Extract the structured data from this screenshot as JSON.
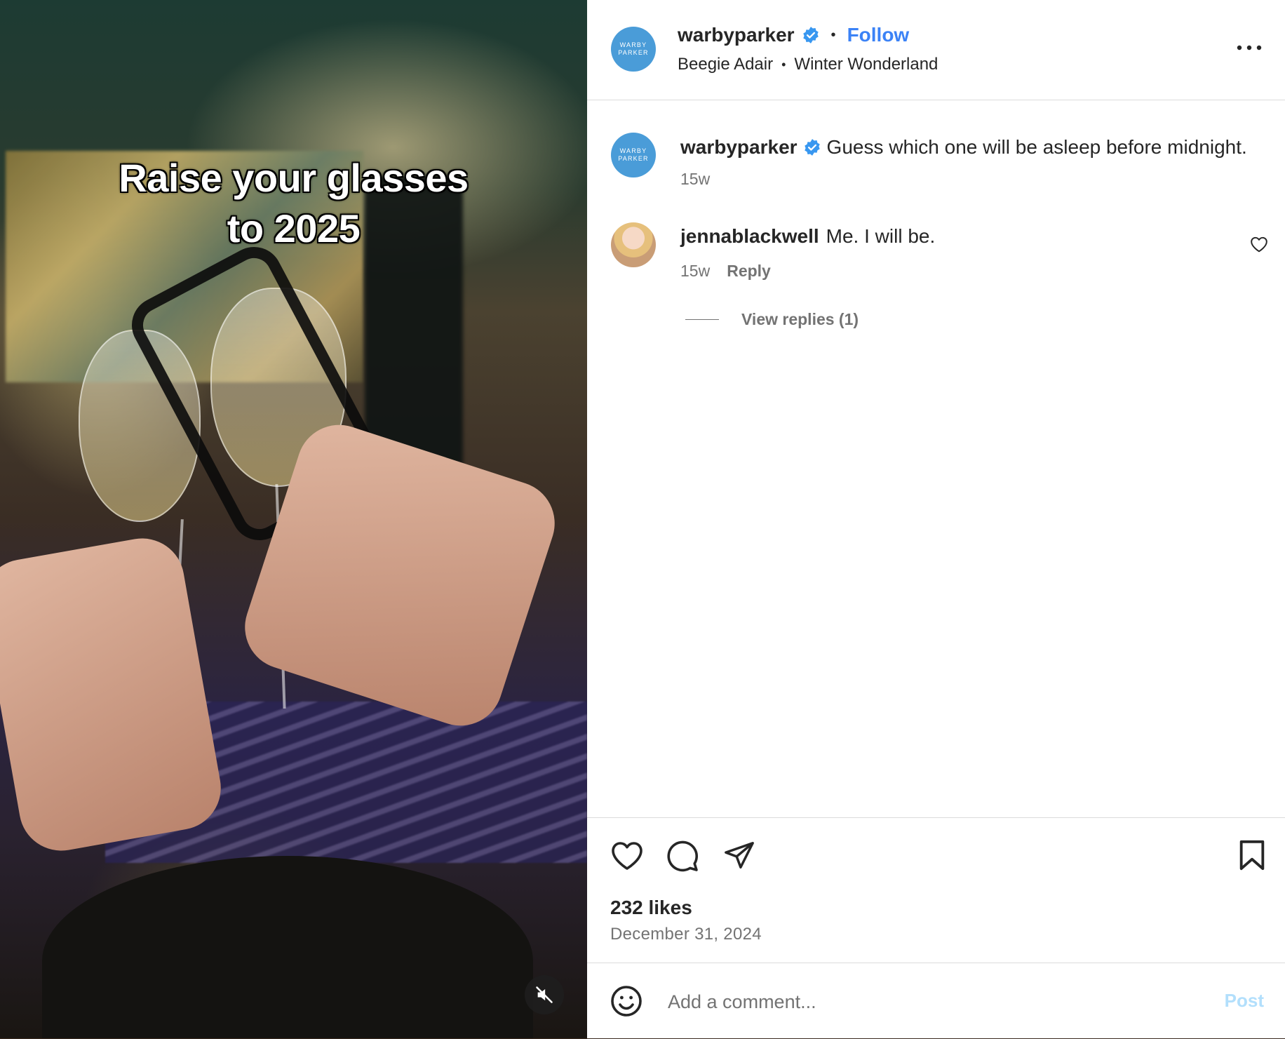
{
  "post": {
    "caption_overlay_line1": "Raise your glasses",
    "caption_overlay_line2": "to 2025"
  },
  "header": {
    "avatar_text_line1": "WARBY",
    "avatar_text_line2": "PARKER",
    "username": "warbyparker",
    "separator": "•",
    "follow_label": "Follow",
    "collab_name": "Beegie Adair",
    "audio_sep": "•",
    "audio_name": "Winter Wonderland",
    "more_icon": "more-options-icon"
  },
  "caption": {
    "username": "warbyparker",
    "text": "Guess which one will be asleep before midnight.",
    "time": "15w"
  },
  "comments": [
    {
      "username": "jennablackwell",
      "text": "Me. I will be.",
      "time": "15w",
      "reply_label": "Reply",
      "view_replies_label": "View replies (1)"
    }
  ],
  "actions": {
    "likes": "232 likes",
    "date": "December 31, 2024"
  },
  "add_comment": {
    "placeholder": "Add a comment...",
    "post_label": "Post"
  },
  "colors": {
    "accent": "#3b82f6",
    "verified": "#3897f0",
    "avatar": "#4a9cd8",
    "post_disabled": "#b2dffc"
  }
}
